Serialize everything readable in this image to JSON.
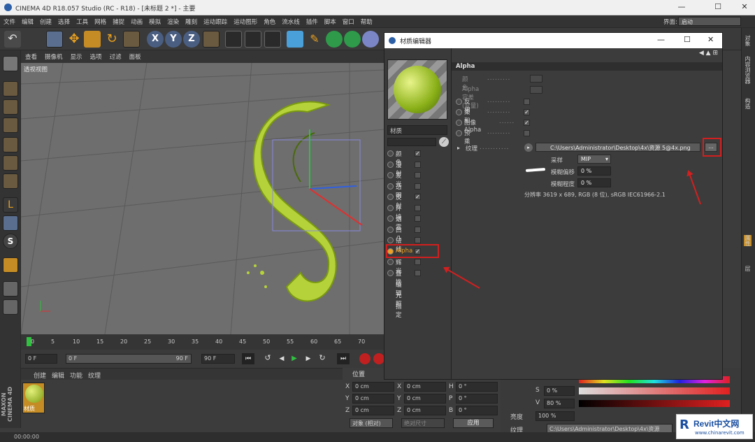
{
  "window": {
    "title": "CINEMA 4D R18.057 Studio (RC - R18) - [未标题 2 *] - 主要",
    "layout_label": "界面:",
    "layout_value": "启动"
  },
  "menu": [
    "文件",
    "编辑",
    "创建",
    "选择",
    "工具",
    "网格",
    "捕捉",
    "动画",
    "模拟",
    "渲染",
    "雕刻",
    "运动跟踪",
    "运动图形",
    "角色",
    "流水线",
    "插件",
    "脚本",
    "窗口",
    "帮助"
  ],
  "viewport": {
    "menu": [
      "查看",
      "摄像机",
      "显示",
      "选项",
      "过滤",
      "面板"
    ],
    "label": "透视视图"
  },
  "timeline": {
    "ticks": [
      "0",
      "5",
      "10",
      "15",
      "20",
      "25",
      "30",
      "35",
      "40",
      "45",
      "50",
      "55",
      "60",
      "65",
      "70"
    ],
    "frame_start": "0 F",
    "frame_current": "0 F",
    "frame_end": "90 F",
    "frame_end2": "90 F"
  },
  "material_manager": {
    "menu": [
      "创建",
      "编辑",
      "功能",
      "纹理"
    ],
    "material_name": "材质"
  },
  "coords": {
    "header": "位置",
    "rows": [
      {
        "a": "X",
        "av": "0 cm",
        "b": "X",
        "bv": "0 cm",
        "c": "H",
        "cv": "0 °"
      },
      {
        "a": "Y",
        "av": "0 cm",
        "b": "Y",
        "bv": "0 cm",
        "c": "P",
        "cv": "0 °"
      },
      {
        "a": "Z",
        "av": "0 cm",
        "b": "Z",
        "bv": "0 cm",
        "c": "B",
        "cv": "0 °"
      }
    ],
    "mode": "对象 (相对)",
    "size_mode": "绝对尺寸",
    "apply": "应用"
  },
  "status": {
    "time": "00:00:00"
  },
  "right_panel": {
    "s_label": "S",
    "s_value": "0 %",
    "v_label": "V",
    "v_value": "80 %",
    "brightness_label": "亮度",
    "brightness_value": "100 %",
    "texture_label": "纹理",
    "texture_path": "C:\\Users\\Administrator\\Desktop\\4x\\资源"
  },
  "right_tabs": [
    "对象",
    "内容浏览器",
    "构造",
    "属性",
    "层"
  ],
  "dialog": {
    "title": "材质编辑器",
    "material_label": "材质",
    "channels": [
      {
        "name": "颜色",
        "radio": true,
        "checked": "✓"
      },
      {
        "name": "漫射",
        "radio": true,
        "checked": ""
      },
      {
        "name": "发光",
        "radio": true,
        "checked": ""
      },
      {
        "name": "透明",
        "radio": true,
        "checked": ""
      },
      {
        "name": "反射",
        "radio": true,
        "checked": "✓"
      },
      {
        "name": "环境",
        "radio": true,
        "checked": ""
      },
      {
        "name": "烟雾",
        "radio": true,
        "checked": ""
      },
      {
        "name": "凹凸",
        "radio": true,
        "checked": ""
      },
      {
        "name": "法线",
        "radio": true,
        "checked": ""
      },
      {
        "name": "Alpha",
        "radio": true,
        "checked": "✓"
      },
      {
        "name": "辉光",
        "radio": true,
        "checked": ""
      },
      {
        "name": "置换",
        "radio": true,
        "checked": ""
      },
      {
        "name": "编辑",
        "radio": false,
        "checked": ""
      },
      {
        "name": "光照",
        "radio": false,
        "checked": ""
      },
      {
        "name": "指定",
        "radio": false,
        "checked": ""
      }
    ],
    "section_title": "Alpha",
    "props": [
      {
        "name": "颜色",
        "checked": ""
      },
      {
        "name": "Alpha容差 (变量)",
        "checked": ""
      },
      {
        "name": "反相",
        "checked": ""
      },
      {
        "name": "柔和",
        "checked": "✓"
      },
      {
        "name": "图像 Alpha",
        "checked": "✓"
      },
      {
        "name": "预乘",
        "checked": ""
      }
    ],
    "texture_label": "纹理",
    "texture_path": "C:\\Users\\Administrator\\Desktop\\4x\\资源 5@4x.png",
    "browse_button": "...",
    "sampling_label": "采样",
    "sampling_value": "MIP",
    "blur_offset_label": "模糊偏移",
    "blur_offset_value": "0 %",
    "blur_scale_label": "模糊程度",
    "blur_scale_value": "0 %",
    "resolution": "分辨率 3619 x 689, RGB (8 位), sRGB IEC61966-2.1"
  },
  "watermark": {
    "brand": "Revit中文网",
    "url": "www.chinarevit.com"
  },
  "colors": {
    "accent": "#d21f1f",
    "leaf": "#b6d23a",
    "viewport": "#6e6e6e"
  }
}
